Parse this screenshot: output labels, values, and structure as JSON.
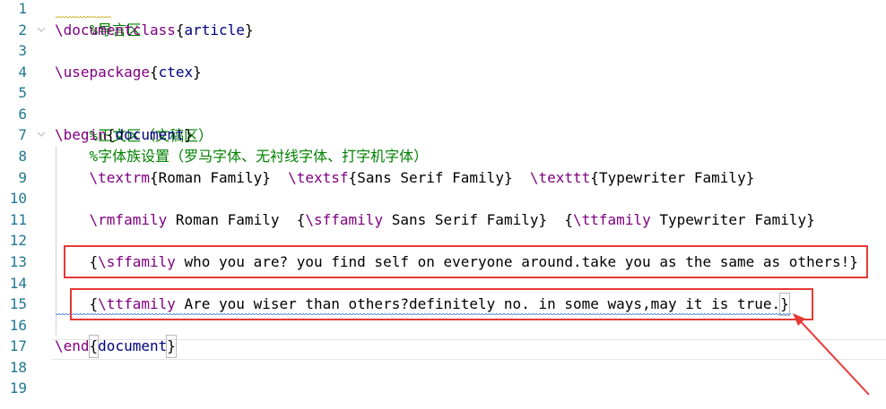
{
  "gutter": {
    "line_numbers": [
      "1",
      "2",
      "3",
      "4",
      "5",
      "6",
      "7",
      "8",
      "9",
      "10",
      "11",
      "12",
      "13",
      "14",
      "15",
      "16",
      "17",
      "18",
      "19"
    ]
  },
  "icons": {
    "fold_open": "chevron-down-icon",
    "annotation_arrow": "arrow-icon"
  },
  "colors": {
    "comment": "#008000",
    "command": "#800080",
    "argument": "#000080",
    "line_number": "#237893",
    "annotation": "#e53935",
    "squiggle": "#2a6fd6"
  },
  "lines": {
    "l1": {
      "comment": "%导言区"
    },
    "l2": {
      "cmd": "\\documentclass",
      "open": "{",
      "arg": "article",
      "close": "}"
    },
    "l4": {
      "cmd": "\\usepackage",
      "open": "{",
      "arg": "ctex",
      "close": "}"
    },
    "l6": {
      "comment": "%正文区（文稿区）"
    },
    "l7": {
      "cmd": "\\begin",
      "open": "{",
      "arg": "document",
      "close": "}"
    },
    "l8": {
      "indent": "    ",
      "comment": "%字体族设置（罗马字体、无衬线字体、打字机字体）"
    },
    "l9": {
      "indent": "    ",
      "cmd1": "\\textrm",
      "open1": "{",
      "txt1": "Roman Family",
      "close1": "}",
      "sp1": "  ",
      "cmd2": "\\textsf",
      "open2": "{",
      "txt2": "Sans Serif Family",
      "close2": "}",
      "sp2": "  ",
      "cmd3": "\\texttt",
      "open3": "{",
      "txt3": "Typewriter Family",
      "close3": "}"
    },
    "l11": {
      "indent": "    ",
      "cmd1": "\\rmfamily",
      "txt1": " Roman Family  ",
      "open2": "{",
      "cmd2": "\\sffamily",
      "txt2": " Sans Serif Family",
      "close2": "}",
      "sp": "  ",
      "open3": "{",
      "cmd3": "\\ttfamily",
      "txt3": " Typewriter Family",
      "close3": "}"
    },
    "l13": {
      "indent": "    ",
      "open": "{",
      "cmd": "\\sffamily",
      "txt": " who you are? you find self on everyone around.take you as the same as others!",
      "close": "}"
    },
    "l15": {
      "indent": "    ",
      "open": "{",
      "cmd": "\\ttfamily",
      "txt": " Are you wiser than others?definitely no. in some ways,may it is true.",
      "close": "}"
    },
    "l17": {
      "cmd": "\\end",
      "open": "{",
      "arg": "document",
      "close": "}"
    }
  }
}
